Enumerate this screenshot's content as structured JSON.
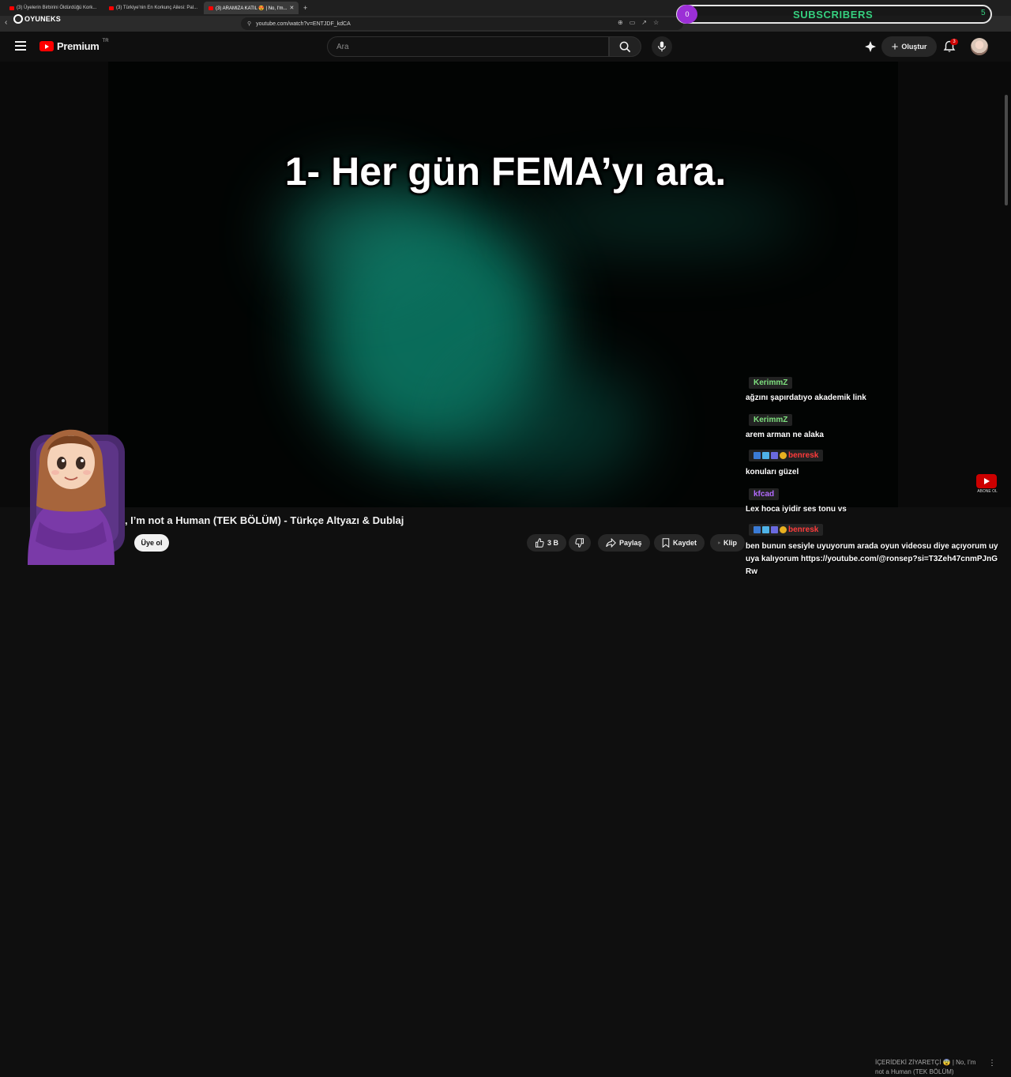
{
  "browser": {
    "tabs": [
      {
        "label": "(3) Üyelerin Birbirini Öldürdüğü Kork..."
      },
      {
        "label": "(3) Türkiye'nin En Korkunç Ailesi: Pal..."
      },
      {
        "label": "(3) ARAMIZA KATIL 😍 | No, I'm..."
      }
    ],
    "url": "youtube.com/watch?v=ENTJDF_kdCA"
  },
  "overlay": {
    "brand_name": "OYUNEKS",
    "subscribers_label": "SUBSCRIBERS",
    "subscribers_count": "0",
    "subscribers_goal": "5"
  },
  "header": {
    "logo_text": "Premium",
    "region": "TR",
    "search_placeholder": "Ara",
    "create_label": "Oluştur",
    "notification_count": "3"
  },
  "video": {
    "subtitle": "1- Her gün FEMA’yı ara.",
    "title": "o, I’m not a Human (TEK BÖLÜM) - Türkçe Altyazı & Dublaj"
  },
  "actions": {
    "join_label": "Üye ol",
    "like_count": "3 B",
    "share_label": "Paylaş",
    "save_label": "Kaydet",
    "clip_label": "Klip"
  },
  "chat": {
    "messages": [
      {
        "user": "KerimmZ",
        "user_color": "#7ee07e",
        "text": "ağzını şapırdatıyo akademik link"
      },
      {
        "user": "KerimmZ",
        "user_color": "#7ee07e",
        "text": "arem arman ne alaka"
      },
      {
        "user": "benresk",
        "user_color": "#ff3b3b",
        "text": "konuları güzel"
      },
      {
        "user": "kfcad",
        "user_color": "#b36bff",
        "text": "Lex hoca iyidir ses tonu vs"
      },
      {
        "user": "benresk",
        "user_color": "#ff3b3b",
        "text": "ben bunun sesiyle uyuyorum arada oyun videosu diye açıyorum uyuya kalıyorum https://youtube.com/@ronsep?si=T3Zeh47cnmPJnGRw"
      }
    ]
  },
  "corner": {
    "label": "ABONE OL",
    "next_video": "İÇERİDEKİ ZİYARETÇİ 😨 | No, I’m not a Human (TEK BÖLÜM)"
  },
  "colors": {
    "youtube_red": "#ff0000",
    "subscriber_green": "#35d07f",
    "bubble_purple": "#9b2fd6",
    "video_glow": "#0d8f77"
  }
}
